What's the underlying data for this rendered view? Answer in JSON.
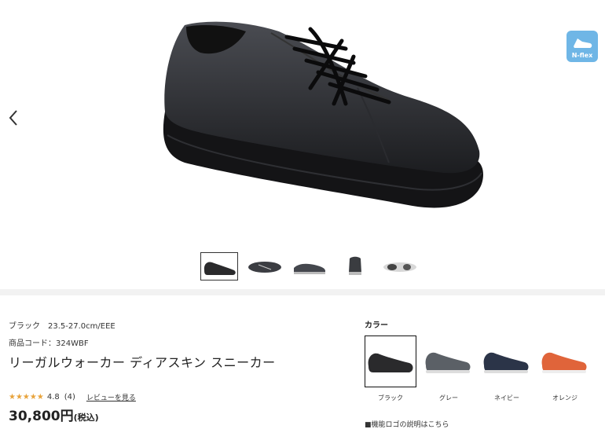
{
  "gallery": {
    "badge": {
      "label": "N-flex",
      "icon": "shoe-flex-icon",
      "color": "#6fb6e6"
    },
    "prev_icon": "chevron-left-icon"
  },
  "product": {
    "color_name": "ブラック",
    "size_range": "23.5-27.0cm/EEE",
    "code_label": "商品コード：",
    "code": "324WBF",
    "title": "リーガルウォーカー ディアスキン スニーカー",
    "stars": "★★★★★",
    "rating": "4.8",
    "review_count": "(4)",
    "review_link": "レビューを見る",
    "price": "30,800円",
    "tax_note": "(税込)"
  },
  "colors": {
    "label": "カラー",
    "options": [
      {
        "name": "ブラック",
        "hex": "#2a2a2c"
      },
      {
        "name": "グレー",
        "hex": "#5b6066"
      },
      {
        "name": "ネイビー",
        "hex": "#2b3448"
      },
      {
        "name": "オレンジ",
        "hex": "#e0643a"
      }
    ],
    "logo_note": "■機能ロゴの説明はこちら"
  }
}
